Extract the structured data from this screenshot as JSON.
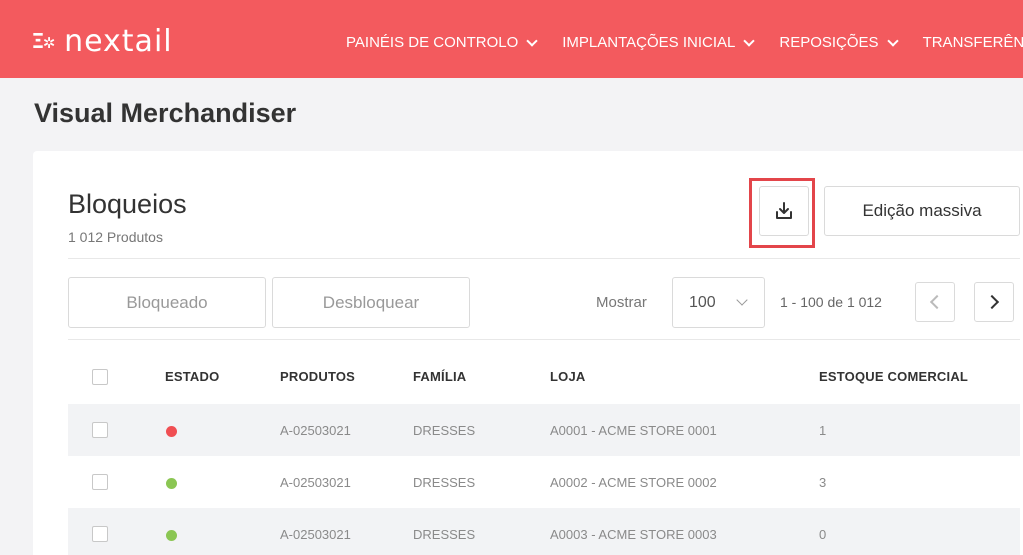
{
  "app": {
    "logo_mark": "Ξ✲",
    "logo_text": "nextail"
  },
  "nav": {
    "items": [
      {
        "label": "PAINÉIS DE CONTROLO"
      },
      {
        "label": "IMPLANTAÇÕES INICIAL"
      },
      {
        "label": "REPOSIÇÕES"
      },
      {
        "label": "TRANSFERÊNCIAS"
      }
    ]
  },
  "page": {
    "title": "Visual Merchandiser"
  },
  "section": {
    "title": "Bloqueios",
    "subtitle": "1 012 Produtos",
    "download_icon": "download-icon",
    "bulk_edit_label": "Edição massiva"
  },
  "actions": {
    "block_label": "Bloqueado",
    "unblock_label": "Desbloquear"
  },
  "pagination": {
    "show_label": "Mostrar",
    "page_size": "100",
    "range": "1 - 100 de 1 012"
  },
  "table": {
    "columns": [
      "ESTADO",
      "PRODUTOS",
      "FAMÍLIA",
      "LOJA",
      "ESTOQUE COMERCIAL"
    ],
    "rows": [
      {
        "status": "red",
        "product": "A-02503021",
        "family": "DRESSES",
        "store": "A0001 - ACME STORE 0001",
        "stock": "1"
      },
      {
        "status": "green",
        "product": "A-02503021",
        "family": "DRESSES",
        "store": "A0002 - ACME STORE 0002",
        "stock": "3"
      },
      {
        "status": "green",
        "product": "A-02503021",
        "family": "DRESSES",
        "store": "A0003 - ACME STORE 0003",
        "stock": "0"
      }
    ]
  },
  "colors": {
    "brand": "#f35a5e",
    "status_red": "#f04e52",
    "status_green": "#8bc653",
    "highlight": "#e3454a"
  }
}
